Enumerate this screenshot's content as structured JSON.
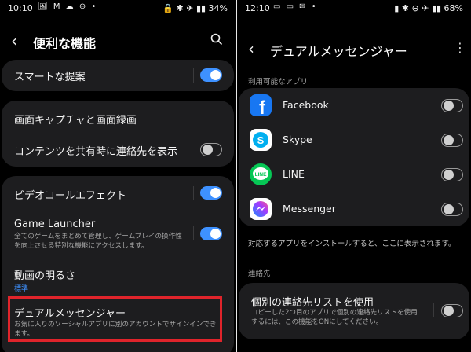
{
  "left": {
    "status": {
      "time": "10:10",
      "icons": "🖼 M ☁ ⊖ •",
      "right": "🔒 ✱ ✈ ▮▮ 34%"
    },
    "header": {
      "title": "便利な機能"
    },
    "groups": [
      {
        "rows": [
          {
            "title": "スマートな提案",
            "toggle": "on"
          }
        ]
      },
      {
        "rows": [
          {
            "title": "画面キャプチャと画面録画"
          },
          {
            "title": "コンテンツを共有時に連絡先を表示",
            "toggle": "off"
          }
        ]
      },
      {
        "rows": [
          {
            "title": "ビデオコールエフェクト",
            "toggle": "on"
          },
          {
            "title": "Game Launcher",
            "desc": "全てのゲームをまとめて管理し、ゲームプレイの操作性を向上させる特別な機能にアクセスします。",
            "toggle": "on"
          },
          {
            "title": "動画の明るさ",
            "sub": "標準"
          },
          {
            "title": "デュアルメッセンジャー",
            "desc": "お気に入りのソーシャルアプリに別のアカウントでサインインできます。"
          }
        ]
      }
    ]
  },
  "right": {
    "status": {
      "time": "12:10",
      "icons": "▭ ▭ ✉ •",
      "right": "▮ ✱ ⊖ ✈ ▮▮ 68%"
    },
    "header": {
      "title": "デュアルメッセンジャー"
    },
    "section_apps": "利用可能なアプリ",
    "apps": [
      {
        "name": "Facebook",
        "icon": "facebook-icon",
        "color": "#1877f2",
        "glyph": "f",
        "toggle": "off"
      },
      {
        "name": "Skype",
        "icon": "skype-icon",
        "color": "#00aff0",
        "glyph": "S",
        "toggle": "off"
      },
      {
        "name": "LINE",
        "icon": "line-icon",
        "color": "#06c755",
        "glyph": "LINE",
        "toggle": "off"
      },
      {
        "name": "Messenger",
        "icon": "messenger-icon",
        "color": "#8b5cf6",
        "glyph": "⚡",
        "toggle": "off"
      }
    ],
    "note": "対応するアプリをインストールすると、ここに表示されます。",
    "section_contacts": "連絡先",
    "contacts_row": {
      "title": "個別の連絡先リストを使用",
      "desc": "コピーした2つ目のアプリで個別の連絡先リストを使用するには、この機能をONにしてください。",
      "toggle": "off"
    }
  }
}
